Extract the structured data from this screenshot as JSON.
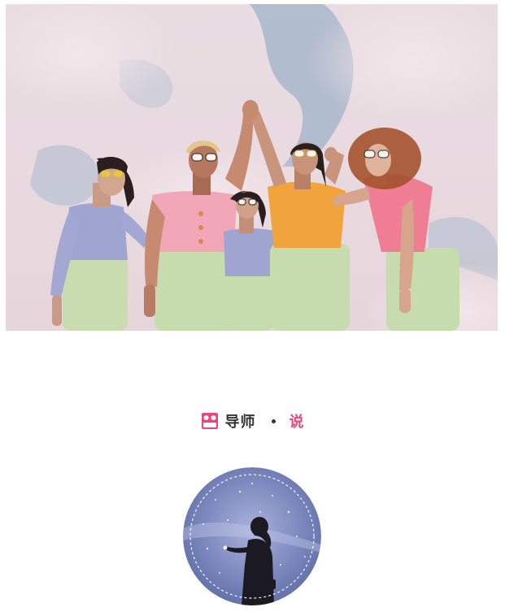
{
  "hero_photo": {
    "alt": "",
    "icon": "group-photo"
  },
  "section_heading": {
    "label": "导师",
    "accent": "说",
    "icon": "tag-icon",
    "accent_color": "#f0457a",
    "icon_color": "#f0457a"
  },
  "avatar": {
    "icon": "mentor-avatar"
  }
}
